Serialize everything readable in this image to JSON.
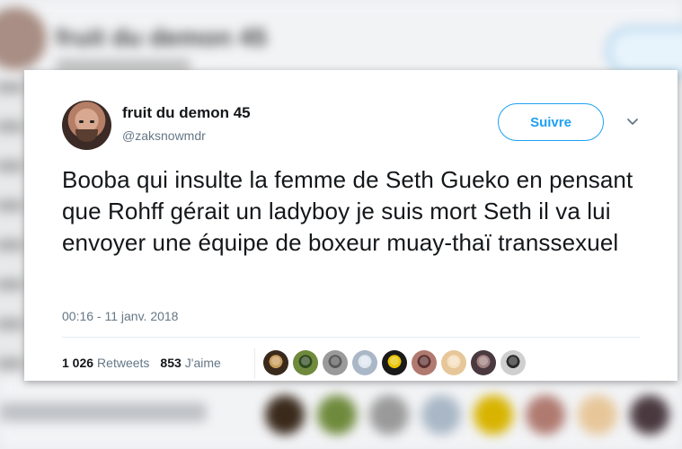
{
  "tweet": {
    "display_name": "fruit du demon 45",
    "handle": "@zaksnowmdr",
    "follow_label": "Suivre",
    "text": "Booba qui insulte la femme de Seth Gueko en pensant que Rohff gérait un ladyboy je suis mort Seth il va lui envoyer une équipe de boxeur muay-thaï transsexuel",
    "timestamp": "00:16 - 11 janv. 2018",
    "retweets_count": "1 026",
    "retweets_label": "Retweets",
    "likes_count": "853",
    "likes_label": "J'aime",
    "liker_avatar_colors": [
      "#3a2a1c",
      "#6f8a3c",
      "#9a9a9a",
      "#a9b7c6",
      "#1a1a1a",
      "#b07a70",
      "#e7c79a",
      "#4a3a40",
      "#cfcfcf"
    ],
    "liker_accent_colors": [
      "#c89c5a",
      "#2e4a1f",
      "#5a5a5a",
      "#dfe7ef",
      "#e8c400",
      "#5c3030",
      "#f5e0c0",
      "#a08080",
      "#2a2a2a"
    ]
  },
  "colors": {
    "accent": "#1da1f2",
    "text": "#14171a",
    "muted": "#657786"
  }
}
